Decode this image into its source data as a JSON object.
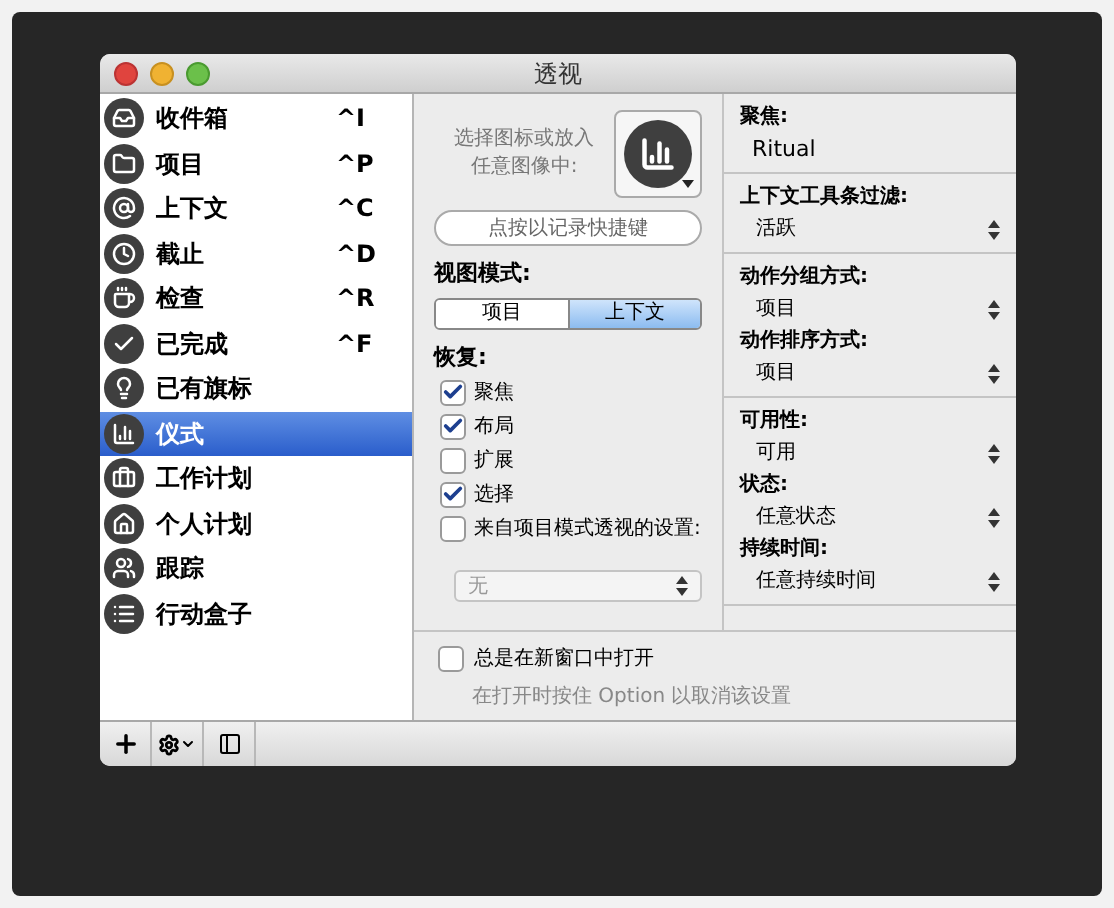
{
  "window": {
    "title": "透视"
  },
  "sidebar": {
    "items": [
      {
        "kind": "inbox",
        "label": "收件箱",
        "shortcut": "^I",
        "selected": false
      },
      {
        "kind": "projects",
        "label": "项目",
        "shortcut": "^P",
        "selected": false
      },
      {
        "kind": "contexts",
        "label": "上下文",
        "shortcut": "^C",
        "selected": false
      },
      {
        "kind": "due",
        "label": "截止",
        "shortcut": "^D",
        "selected": false
      },
      {
        "kind": "review",
        "label": "检查",
        "shortcut": "^R",
        "selected": false
      },
      {
        "kind": "done",
        "label": "已完成",
        "shortcut": "^F",
        "selected": false
      },
      {
        "kind": "flag",
        "label": "已有旗标",
        "selected": false
      },
      {
        "kind": "chart",
        "label": "仪式",
        "selected": true
      },
      {
        "kind": "work",
        "label": "工作计划",
        "selected": false
      },
      {
        "kind": "home",
        "label": "个人计划",
        "selected": false
      },
      {
        "kind": "people",
        "label": "跟踪",
        "selected": false
      },
      {
        "kind": "box",
        "label": "行动盒子",
        "selected": false
      }
    ]
  },
  "middle": {
    "icon_prompt": [
      "选择图标或放入",
      "任意图像中:"
    ],
    "shortcut_button": "点按以记录快捷键",
    "view_mode": {
      "label": "视图模式:",
      "options": [
        {
          "label": "项目",
          "selected": false
        },
        {
          "label": "上下文",
          "selected": true
        }
      ]
    },
    "restore": {
      "label": "恢复:",
      "options": [
        {
          "label": "聚焦",
          "checked": true
        },
        {
          "label": "布局",
          "checked": true
        },
        {
          "label": "扩展",
          "checked": false
        },
        {
          "label": "选择",
          "checked": true
        },
        {
          "label": "来自项目模式透视的设置:",
          "checked": false
        }
      ]
    },
    "settings_popup": {
      "value": "无",
      "disabled": true
    }
  },
  "right": {
    "sections": [
      [
        {
          "kind": "text",
          "label": "聚焦:",
          "value": "Ritual"
        }
      ],
      [
        {
          "kind": "popup",
          "label": "上下文工具条过滤:",
          "value": "活跃"
        }
      ],
      [
        {
          "kind": "popup",
          "label": "动作分组方式:",
          "value": "项目"
        },
        {
          "kind": "popup",
          "label": "动作排序方式:",
          "value": "项目"
        }
      ],
      [
        {
          "kind": "popup",
          "label": "可用性:",
          "value": "可用"
        },
        {
          "kind": "popup",
          "label": "状态:",
          "value": "任意状态"
        },
        {
          "kind": "popup",
          "label": "持续时间:",
          "value": "任意持续时间"
        }
      ]
    ]
  },
  "footer": {
    "open_new_window": {
      "label": "总是在新窗口中打开",
      "checked": false
    },
    "hint": "在打开时按住 Option 以取消该设置"
  }
}
